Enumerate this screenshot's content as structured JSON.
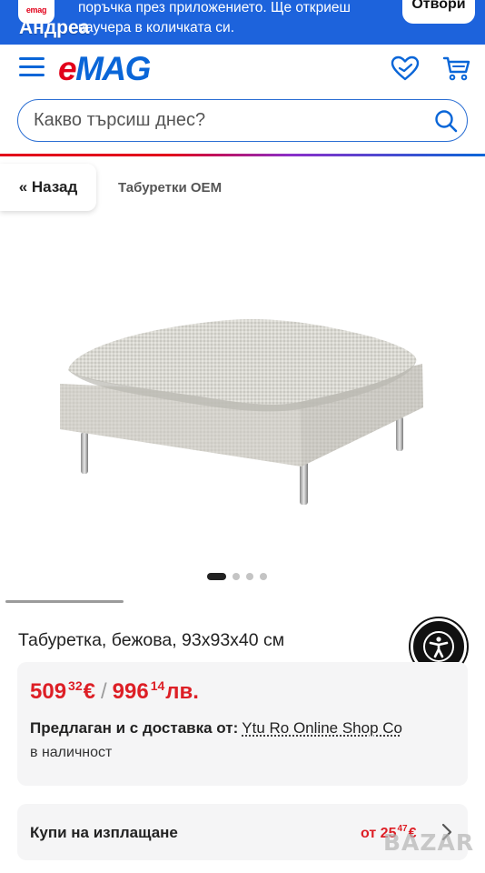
{
  "banner": {
    "app_icon_text": "emag",
    "user_name": "Андреа",
    "promo_line1": "поръчка през приложението. Ще откриеш",
    "promo_line2": "ваучера в количката си.",
    "open_label": "Отвори"
  },
  "header": {
    "logo_e": "e",
    "logo_mag": "MAG",
    "search_placeholder": "Какво търсиш днес?",
    "icons": [
      "menu-icon",
      "heart-icon",
      "cart-icon",
      "search-icon"
    ]
  },
  "breadcrumb": {
    "back_label": "« Назад",
    "category": "Табуретки OEM"
  },
  "gallery": {
    "image_count": 4,
    "active_index": 0
  },
  "product": {
    "title": "Табуретка, бежова, 93x93x40 см",
    "price_eur_int": "509",
    "price_eur_dec": "32",
    "price_eur_currency": "€",
    "price_sep": "/",
    "price_bgn_int": "996",
    "price_bgn_dec": "14",
    "price_bgn_currency": "лв.",
    "seller_prefix": "Предлаган и с доставка от:",
    "seller_name": "Ytu Ro Online Shop Co",
    "stock": "в наличност",
    "installments_label": "Купи на изплащане",
    "installments_prefix": "от",
    "installments_int": "25",
    "installments_dec": "47",
    "installments_currency": "€"
  },
  "watermark": "BAZAR",
  "colors": {
    "brand_blue": "#0a66d8",
    "brand_red": "#e2001a",
    "price_red": "#dd1f26",
    "banner_blue": "#1d63dc"
  }
}
